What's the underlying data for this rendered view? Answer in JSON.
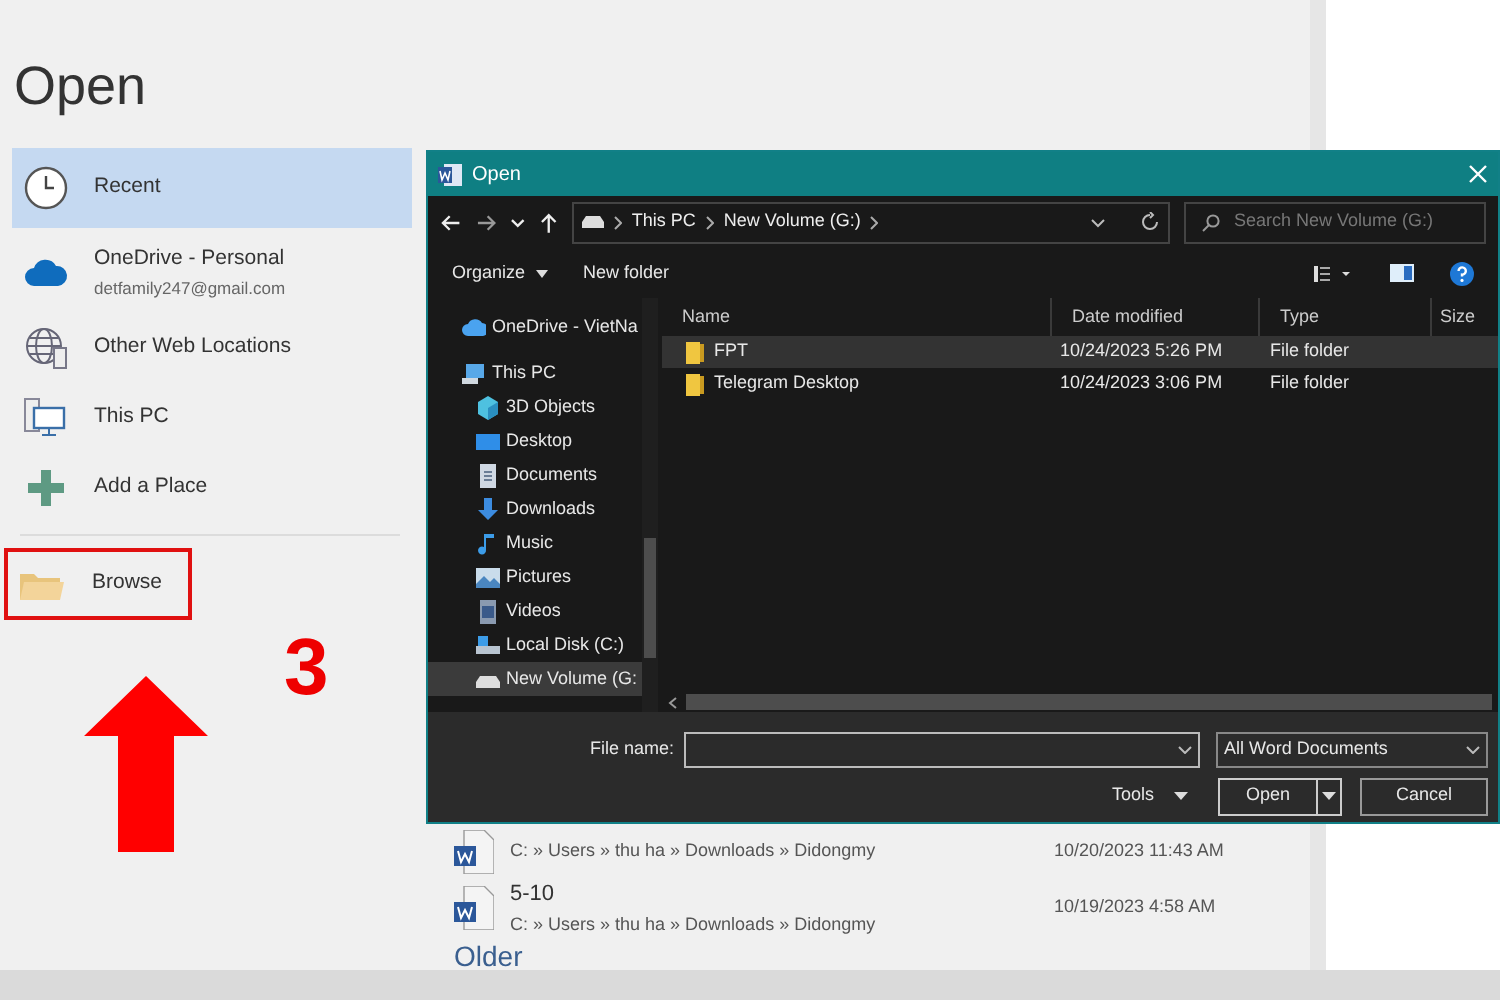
{
  "backstage": {
    "title": "Open",
    "places": [
      {
        "kind": "recent",
        "label": "Recent",
        "selected": true
      },
      {
        "kind": "onedrive",
        "label": "OneDrive - Personal",
        "sublabel": "detfamily247@gmail.com",
        "selected": false
      },
      {
        "kind": "web",
        "label": "Other Web Locations",
        "selected": false
      },
      {
        "kind": "pc",
        "label": "This PC",
        "selected": false
      },
      {
        "kind": "add",
        "label": "Add a Place",
        "selected": false
      }
    ],
    "browse": {
      "label": "Browse"
    },
    "recent_files": [
      {
        "path": "C: » Users » thu ha » Downloads » Didongmy",
        "date": "10/20/2023 11:43 AM"
      },
      {
        "name": "5-10",
        "path": "C: » Users » thu ha » Downloads » Didongmy",
        "date": "10/19/2023 4:58 AM"
      }
    ],
    "section_heading": "Older"
  },
  "annotation": {
    "step": "3"
  },
  "dialog": {
    "title": "Open",
    "address": [
      "This PC",
      "New Volume (G:)"
    ],
    "search": {
      "placeholder": "Search New Volume (G:)"
    },
    "toolbar": [
      "Organize",
      "New folder"
    ],
    "nav": [
      {
        "kind": "cloud",
        "label": "OneDrive - VietNa",
        "selected": false
      },
      {
        "kind": "pc",
        "label": "This PC",
        "selected": false,
        "children": [
          {
            "kind": "cube",
            "label": "3D Objects",
            "selected": false
          },
          {
            "kind": "desktop",
            "label": "Desktop",
            "selected": false
          },
          {
            "kind": "doc",
            "label": "Documents",
            "selected": false
          },
          {
            "kind": "download",
            "label": "Downloads",
            "selected": false
          },
          {
            "kind": "music",
            "label": "Music",
            "selected": false
          },
          {
            "kind": "pictures",
            "label": "Pictures",
            "selected": false
          },
          {
            "kind": "videos",
            "label": "Videos",
            "selected": false
          },
          {
            "kind": "disk",
            "label": "Local Disk (C:)",
            "selected": false
          },
          {
            "kind": "drive",
            "label": "New Volume (G:",
            "selected": true
          }
        ]
      }
    ],
    "columns": [
      "Name",
      "Date modified",
      "Type",
      "Size"
    ],
    "files": [
      {
        "name": "FPT",
        "date": "10/24/2023 5:26 PM",
        "type": "File folder",
        "selected": true
      },
      {
        "name": "Telegram Desktop",
        "date": "10/24/2023 3:06 PM",
        "type": "File folder",
        "selected": false
      }
    ],
    "file_name_label": "File name:",
    "filter": "All Word Documents",
    "tools": "Tools",
    "buttons": [
      "Open",
      "Cancel"
    ]
  }
}
